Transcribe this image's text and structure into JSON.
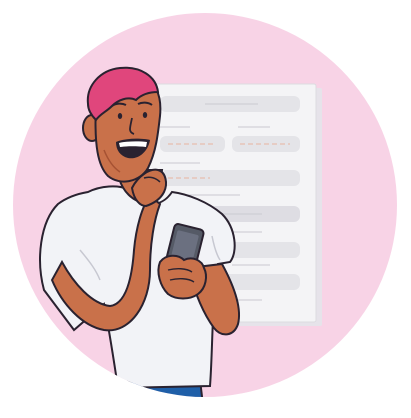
{
  "illustration": {
    "subject": "person-holding-phone",
    "icon_names": [
      "document-form-icon",
      "smartphone-icon"
    ],
    "colors": {
      "background_circle": "#f8d3e6",
      "document": "#f4f4f6",
      "document_field": "#e4e4e8",
      "skin": "#c9714a",
      "skin_shadow": "#a65233",
      "hair": "#e0467c",
      "shirt": "#f2f3f7",
      "jeans": "#1f5fa8",
      "phone": "#555a66",
      "outline": "#2a2230"
    }
  }
}
